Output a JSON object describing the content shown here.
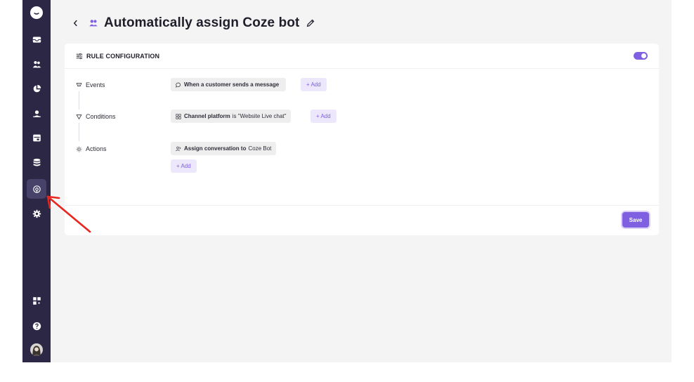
{
  "sidebar": {
    "items": [
      {
        "icon": "chat-bubble-icon"
      },
      {
        "icon": "inbox-icon"
      },
      {
        "icon": "contacts-icon"
      },
      {
        "icon": "reports-pie-icon"
      },
      {
        "icon": "agent-icon"
      },
      {
        "icon": "campaigns-icon"
      },
      {
        "icon": "database-icon"
      },
      {
        "icon": "automation-icon",
        "active": true
      },
      {
        "icon": "settings-gear-icon"
      },
      {
        "icon": "apps-grid-icon"
      },
      {
        "icon": "help-icon"
      },
      {
        "icon": "user-avatar-icon"
      }
    ]
  },
  "header": {
    "title": "Automatically assign Coze bot"
  },
  "card": {
    "title": "RULE CONFIGURATION",
    "enabled": true
  },
  "rules": {
    "events": {
      "label": "Events",
      "chip_text": "When a customer sends a message",
      "add_label": "+ Add"
    },
    "conditions": {
      "label": "Conditions",
      "chip_bold": "Channel platform",
      "chip_text": "is \"Website Live chat\"",
      "add_label": "+ Add"
    },
    "actions": {
      "label": "Actions",
      "chip_bold": "Assign conversation to",
      "chip_text": "Coze Bot",
      "add_label": "+ Add"
    }
  },
  "footer": {
    "save_label": "Save"
  },
  "colors": {
    "sidebar": "#2b2745",
    "accent": "#7f60e0",
    "annotation_arrow": "#e8251f"
  }
}
